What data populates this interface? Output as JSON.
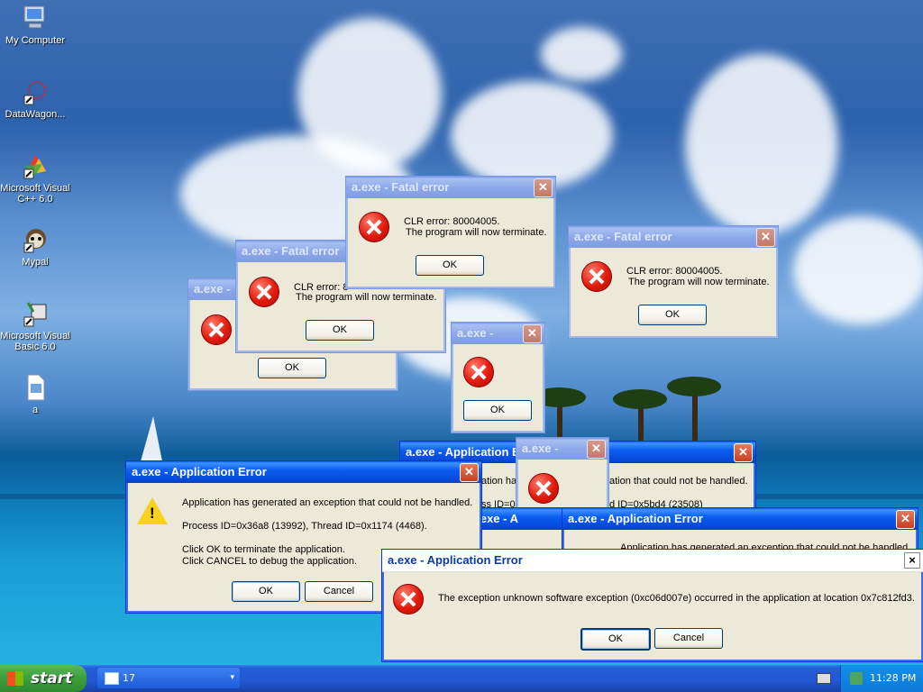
{
  "desktop": {
    "icons": [
      {
        "label": "My Computer"
      },
      {
        "label": "DataWagon..."
      },
      {
        "label": "Microsoft Visual C++ 6.0"
      },
      {
        "label": "Mypal"
      },
      {
        "label": "Microsoft Visual Basic 6.0"
      },
      {
        "label": "a"
      }
    ]
  },
  "dialogs": {
    "fatal_title": "a.exe - Fatal error",
    "fatal_msg_line1": "CLR error: 80004005.",
    "fatal_msg_line2": "The program will now terminate.",
    "fatal_partial_msg": "CLR error: 8",
    "fatal_partial_title_short": "a.exe - ",
    "small_title": "a.exe -",
    "ok_label": "OK",
    "cancel_label": "Cancel",
    "app_error_title": "a.exe - Application Error",
    "app_error_title_partial": "a.exe - Application E",
    "app_error_title_partial2": "a.exe - A",
    "app_error_line1": "Application has generated an exception that could not be handled.",
    "app_error_line2": "Process ID=0x36a8 (13992), Thread ID=0x1174 (4468).",
    "app_error_line3": "Click OK to terminate the application.",
    "app_error_line4": "Click CANCEL to debug the application.",
    "app_error_back_line1": "ation that could not be handled.",
    "app_error_back_line2": "d ID=0x5bd4 (23508)",
    "app_error_back_partial": "Application has generated an exception that could not be handled",
    "app_error_cut1": "ation ha",
    "app_error_cut2": "ss ID=0",
    "exception_msg": "The exception unknown software exception (0xc06d007e) occurred in the application at location 0x7c812fd3.",
    "close_glyph": "✕",
    "close_glyph_plain": "×"
  },
  "taskbar": {
    "start_label": "start",
    "task_label": "17",
    "clock": "11:28 PM"
  },
  "colors": {
    "titlebar_active": "#0b5ef0",
    "start_green": "#3ea33e",
    "dialog_bg": "#ece9d8"
  }
}
